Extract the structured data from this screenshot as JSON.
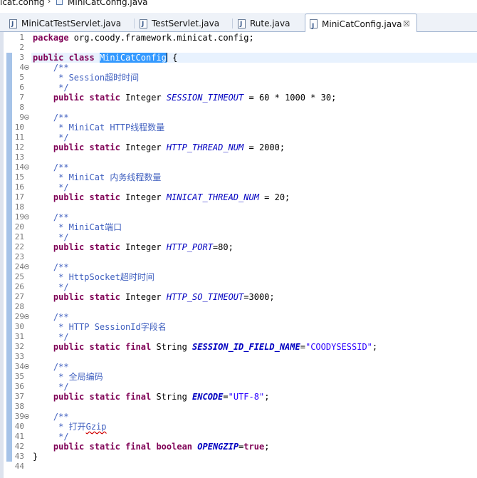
{
  "breadcrumb": {
    "package": "icat.config",
    "file": "MiniCatConfig.java"
  },
  "tabs": [
    {
      "label": "MiniCatTestServlet.java",
      "active": false
    },
    {
      "label": "TestServlet.java",
      "active": false
    },
    {
      "label": "Rute.java",
      "active": false
    },
    {
      "label": "MiniCatConfig.java",
      "active": true,
      "close": "☒"
    }
  ],
  "colors": {
    "keyword": "#7f0055",
    "comment": "#3f5fbf",
    "field": "#0000c0",
    "string": "#2a00ff",
    "selection": "#3399ff"
  },
  "editor": {
    "lines": [
      {
        "n": "1",
        "tokens": [
          [
            "kw",
            "package"
          ],
          [
            "t",
            " org.coody.framework.minicat.config;"
          ]
        ]
      },
      {
        "n": "2",
        "tokens": []
      },
      {
        "n": "3",
        "tokens": [
          [
            "kw",
            "public"
          ],
          [
            "t",
            " "
          ],
          [
            "kw",
            "class"
          ],
          [
            "t",
            " "
          ],
          [
            "sel",
            "MiniCatConfig"
          ],
          [
            "caret",
            ""
          ],
          [
            "t",
            " {"
          ]
        ]
      },
      {
        "n": "4",
        "fold": true,
        "tokens": [
          [
            "t",
            "    "
          ],
          [
            "cm",
            "/**"
          ]
        ]
      },
      {
        "n": "5",
        "tokens": [
          [
            "t",
            "    "
          ],
          [
            "cm",
            " * Session超时时间"
          ]
        ]
      },
      {
        "n": "6",
        "tokens": [
          [
            "t",
            "    "
          ],
          [
            "cm",
            " */"
          ]
        ]
      },
      {
        "n": "7",
        "tokens": [
          [
            "t",
            "    "
          ],
          [
            "kw",
            "public"
          ],
          [
            "t",
            " "
          ],
          [
            "kw",
            "static"
          ],
          [
            "t",
            " Integer "
          ],
          [
            "fld",
            "SESSION_TIMEOUT"
          ],
          [
            "t",
            " = 60 * 1000 * 30;"
          ]
        ]
      },
      {
        "n": "8",
        "tokens": []
      },
      {
        "n": "9",
        "fold": true,
        "tokens": [
          [
            "t",
            "    "
          ],
          [
            "cm",
            "/**"
          ]
        ]
      },
      {
        "n": "10",
        "tokens": [
          [
            "t",
            "    "
          ],
          [
            "cm",
            " * MiniCat HTTP线程数量"
          ]
        ]
      },
      {
        "n": "11",
        "tokens": [
          [
            "t",
            "    "
          ],
          [
            "cm",
            " */"
          ]
        ]
      },
      {
        "n": "12",
        "tokens": [
          [
            "t",
            "    "
          ],
          [
            "kw",
            "public"
          ],
          [
            "t",
            " "
          ],
          [
            "kw",
            "static"
          ],
          [
            "t",
            " Integer "
          ],
          [
            "fld",
            "HTTP_THREAD_NUM"
          ],
          [
            "t",
            " = 2000;"
          ]
        ]
      },
      {
        "n": "13",
        "tokens": []
      },
      {
        "n": "14",
        "fold": true,
        "tokens": [
          [
            "t",
            "    "
          ],
          [
            "cm",
            "/**"
          ]
        ]
      },
      {
        "n": "15",
        "tokens": [
          [
            "t",
            "    "
          ],
          [
            "cm",
            " * MiniCat 内务线程数量"
          ]
        ]
      },
      {
        "n": "16",
        "tokens": [
          [
            "t",
            "    "
          ],
          [
            "cm",
            " */"
          ]
        ]
      },
      {
        "n": "17",
        "tokens": [
          [
            "t",
            "    "
          ],
          [
            "kw",
            "public"
          ],
          [
            "t",
            " "
          ],
          [
            "kw",
            "static"
          ],
          [
            "t",
            " Integer "
          ],
          [
            "fld",
            "MINICAT_THREAD_NUM"
          ],
          [
            "t",
            " = 20;"
          ]
        ]
      },
      {
        "n": "18",
        "tokens": []
      },
      {
        "n": "19",
        "fold": true,
        "tokens": [
          [
            "t",
            "    "
          ],
          [
            "cm",
            "/**"
          ]
        ]
      },
      {
        "n": "20",
        "tokens": [
          [
            "t",
            "    "
          ],
          [
            "cm",
            " * MiniCat端口"
          ]
        ]
      },
      {
        "n": "21",
        "tokens": [
          [
            "t",
            "    "
          ],
          [
            "cm",
            " */"
          ]
        ]
      },
      {
        "n": "22",
        "tokens": [
          [
            "t",
            "    "
          ],
          [
            "kw",
            "public"
          ],
          [
            "t",
            " "
          ],
          [
            "kw",
            "static"
          ],
          [
            "t",
            " Integer "
          ],
          [
            "fld",
            "HTTP_PORT"
          ],
          [
            "t",
            "=80;"
          ]
        ]
      },
      {
        "n": "23",
        "tokens": []
      },
      {
        "n": "24",
        "fold": true,
        "tokens": [
          [
            "t",
            "    "
          ],
          [
            "cm",
            "/**"
          ]
        ]
      },
      {
        "n": "25",
        "tokens": [
          [
            "t",
            "    "
          ],
          [
            "cm",
            " * HttpSocket超时时间"
          ]
        ]
      },
      {
        "n": "26",
        "tokens": [
          [
            "t",
            "    "
          ],
          [
            "cm",
            " */"
          ]
        ]
      },
      {
        "n": "27",
        "tokens": [
          [
            "t",
            "    "
          ],
          [
            "kw",
            "public"
          ],
          [
            "t",
            " "
          ],
          [
            "kw",
            "static"
          ],
          [
            "t",
            " Integer "
          ],
          [
            "fld",
            "HTTP_SO_TIMEOUT"
          ],
          [
            "t",
            "=3000;"
          ]
        ]
      },
      {
        "n": "28",
        "tokens": []
      },
      {
        "n": "29",
        "fold": true,
        "tokens": [
          [
            "t",
            "    "
          ],
          [
            "cm",
            "/**"
          ]
        ]
      },
      {
        "n": "30",
        "tokens": [
          [
            "t",
            "    "
          ],
          [
            "cm",
            " * HTTP SessionId字段名"
          ]
        ]
      },
      {
        "n": "31",
        "tokens": [
          [
            "t",
            "    "
          ],
          [
            "cm",
            " */"
          ]
        ]
      },
      {
        "n": "32",
        "tokens": [
          [
            "t",
            "    "
          ],
          [
            "kw",
            "public"
          ],
          [
            "t",
            " "
          ],
          [
            "kw",
            "static"
          ],
          [
            "t",
            " "
          ],
          [
            "kw",
            "final"
          ],
          [
            "t",
            " String "
          ],
          [
            "fldb",
            "SESSION_ID_FIELD_NAME"
          ],
          [
            "t",
            "="
          ],
          [
            "str",
            "\"COODYSESSID\""
          ],
          [
            "t",
            ";"
          ]
        ]
      },
      {
        "n": "33",
        "tokens": []
      },
      {
        "n": "34",
        "fold": true,
        "tokens": [
          [
            "t",
            "    "
          ],
          [
            "cm",
            "/**"
          ]
        ]
      },
      {
        "n": "35",
        "tokens": [
          [
            "t",
            "    "
          ],
          [
            "cm",
            " * 全局编码"
          ]
        ]
      },
      {
        "n": "36",
        "tokens": [
          [
            "t",
            "    "
          ],
          [
            "cm",
            " */"
          ]
        ]
      },
      {
        "n": "37",
        "tokens": [
          [
            "t",
            "    "
          ],
          [
            "kw",
            "public"
          ],
          [
            "t",
            " "
          ],
          [
            "kw",
            "static"
          ],
          [
            "t",
            " "
          ],
          [
            "kw",
            "final"
          ],
          [
            "t",
            " String "
          ],
          [
            "fldb",
            "ENCODE"
          ],
          [
            "t",
            "="
          ],
          [
            "str",
            "\"UTF-8\""
          ],
          [
            "t",
            ";"
          ]
        ]
      },
      {
        "n": "38",
        "tokens": []
      },
      {
        "n": "39",
        "fold": true,
        "tokens": [
          [
            "t",
            "    "
          ],
          [
            "cm",
            "/**"
          ]
        ]
      },
      {
        "n": "40",
        "tokens": [
          [
            "t",
            "    "
          ],
          [
            "cm",
            " * 打开"
          ],
          [
            "squig",
            "Gzip"
          ]
        ]
      },
      {
        "n": "41",
        "tokens": [
          [
            "t",
            "    "
          ],
          [
            "cm",
            " */"
          ]
        ]
      },
      {
        "n": "42",
        "tokens": [
          [
            "t",
            "    "
          ],
          [
            "kw",
            "public"
          ],
          [
            "t",
            " "
          ],
          [
            "kw",
            "static"
          ],
          [
            "t",
            " "
          ],
          [
            "kw",
            "final"
          ],
          [
            "t",
            " "
          ],
          [
            "kw",
            "boolean"
          ],
          [
            "t",
            " "
          ],
          [
            "fldb",
            "OPENGZIP"
          ],
          [
            "t",
            "="
          ],
          [
            "kw",
            "true"
          ],
          [
            "t",
            ";"
          ]
        ]
      },
      {
        "n": "43",
        "tokens": [
          [
            "t",
            "}"
          ]
        ]
      },
      {
        "n": "44",
        "tokens": []
      }
    ]
  }
}
